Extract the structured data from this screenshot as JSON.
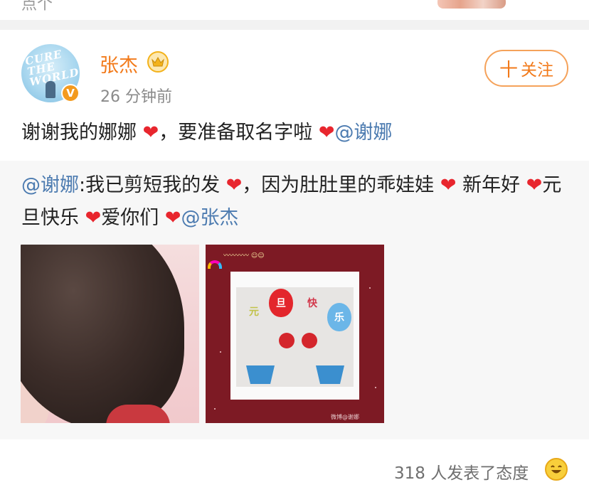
{
  "top": {
    "cut_text": "点个"
  },
  "post": {
    "author": "张杰",
    "time": "26 分钟前",
    "follow_plus": "十",
    "follow_label": "关注",
    "avatar_text": "CURE THE WORLD",
    "verified_badge": "V",
    "text_a": "谢谢我的娜娜 ",
    "text_b": "，要准备取名字啦 ",
    "mention": "@谢娜"
  },
  "repost": {
    "mention_author": "@谢娜",
    "seg1": ":我已剪短我的发 ",
    "seg2": "，因为肚肚里的乖娃娃 ",
    "seg3": " 新年好 ",
    "seg4": "元旦快乐 ",
    "seg5": "爱你们 ",
    "mention_end": "@张杰",
    "image2": {
      "balloons": [
        "元",
        "旦",
        "快",
        "乐"
      ],
      "watermark": "微博@谢娜"
    }
  },
  "footer": {
    "reactions": "318 人发表了态度"
  },
  "icons": [
    "crown-icon",
    "verified-icon",
    "heart-icon",
    "smile-icon",
    "rainbow-icon"
  ],
  "colors": {
    "accent": "#f27a1a",
    "mention": "#4c7bb0",
    "heart": "#e8262e"
  }
}
